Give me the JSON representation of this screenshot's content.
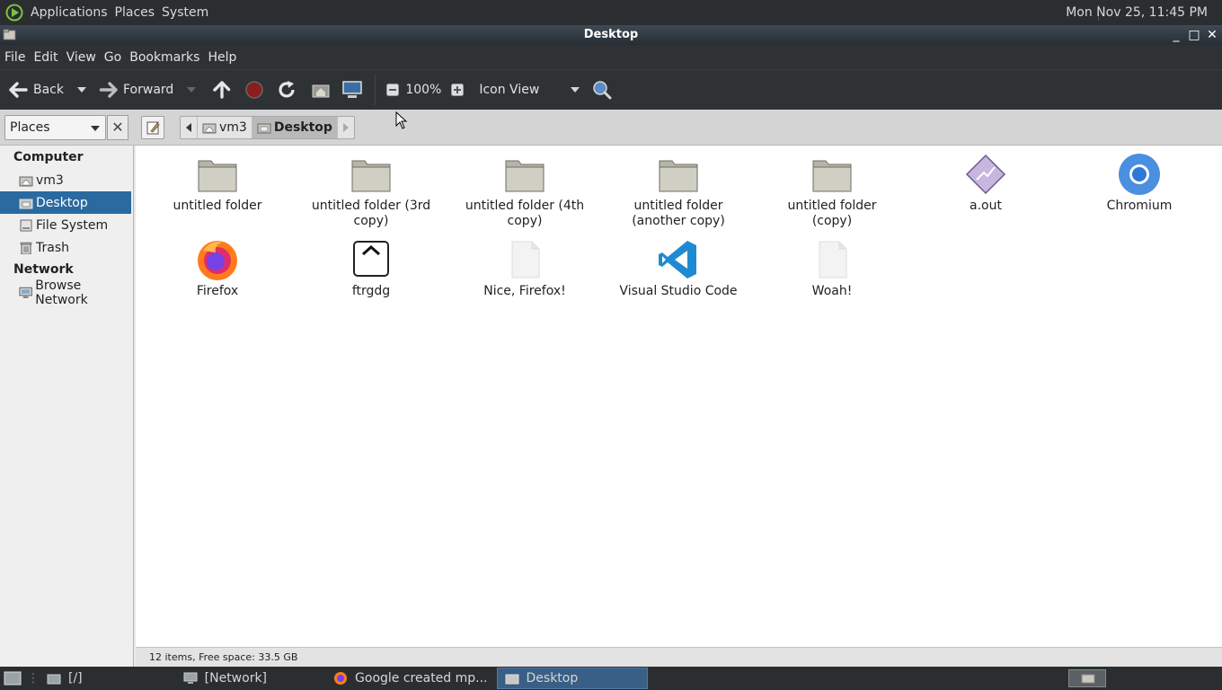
{
  "top_panel": {
    "menus": [
      "Applications",
      "Places",
      "System"
    ],
    "clock": "Mon Nov 25, 11:45 PM"
  },
  "window": {
    "title": "Desktop",
    "controls": {
      "minimize": "_",
      "maximize": "□",
      "close": "✕"
    }
  },
  "menubar": [
    "File",
    "Edit",
    "View",
    "Go",
    "Bookmarks",
    "Help"
  ],
  "toolbar": {
    "back_label": "Back",
    "forward_label": "Forward",
    "zoom_level": "100%",
    "view_mode": "Icon View"
  },
  "location": {
    "side_pane": "Places",
    "crumbs": [
      "vm3",
      "Desktop"
    ]
  },
  "sidebar": {
    "sections": [
      {
        "title": "Computer",
        "items": [
          "vm3",
          "Desktop",
          "File System",
          "Trash"
        ]
      },
      {
        "title": "Network",
        "items": [
          "Browse Network"
        ]
      }
    ],
    "selected": "Desktop"
  },
  "files": [
    {
      "name": "untitled folder",
      "icon": "folder-icon"
    },
    {
      "name": "untitled folder (3rd copy)",
      "icon": "folder-icon"
    },
    {
      "name": "untitled folder (4th copy)",
      "icon": "folder-icon"
    },
    {
      "name": "untitled folder (another copy)",
      "icon": "folder-icon"
    },
    {
      "name": "untitled folder (copy)",
      "icon": "folder-icon"
    },
    {
      "name": "a.out",
      "icon": "executable-icon"
    },
    {
      "name": "Chromium",
      "icon": "chromium-icon"
    },
    {
      "name": "Firefox",
      "icon": "firefox-icon"
    },
    {
      "name": "ftrgdg",
      "icon": "generic-app-icon"
    },
    {
      "name": "Nice, Firefox!",
      "icon": "text-file-icon"
    },
    {
      "name": "Visual Studio Code",
      "icon": "vscode-icon"
    },
    {
      "name": "Woah!",
      "icon": "text-file-icon"
    }
  ],
  "status": "12 items, Free space: 33.5 GB",
  "taskbar": {
    "items": [
      "[/]",
      "[Network]",
      "Google created mp...",
      "Desktop"
    ],
    "active": "Desktop"
  },
  "colors": {
    "selection": "#2a6aa0",
    "panel": "#2b2e30",
    "toolbar": "#2f3235"
  }
}
